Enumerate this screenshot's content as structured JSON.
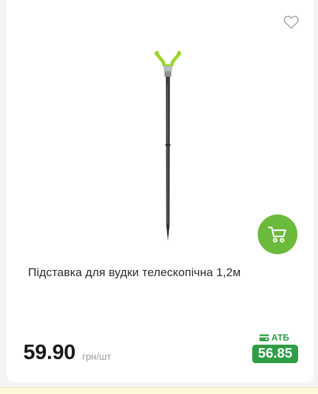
{
  "product": {
    "title": "Підставка для вудки телескопічна 1,2м",
    "price": "59.90",
    "unit": "грн/шт",
    "promo": {
      "label": "АТБ",
      "price": "56.85",
      "color": "#2f9e46"
    }
  },
  "icons": {
    "favorite": "heart-outline-icon",
    "cart": "shopping-cart-icon",
    "promo": "wallet-card-icon"
  },
  "colors": {
    "cart_button": "#6cba3c",
    "promo": "#2f9e46"
  }
}
